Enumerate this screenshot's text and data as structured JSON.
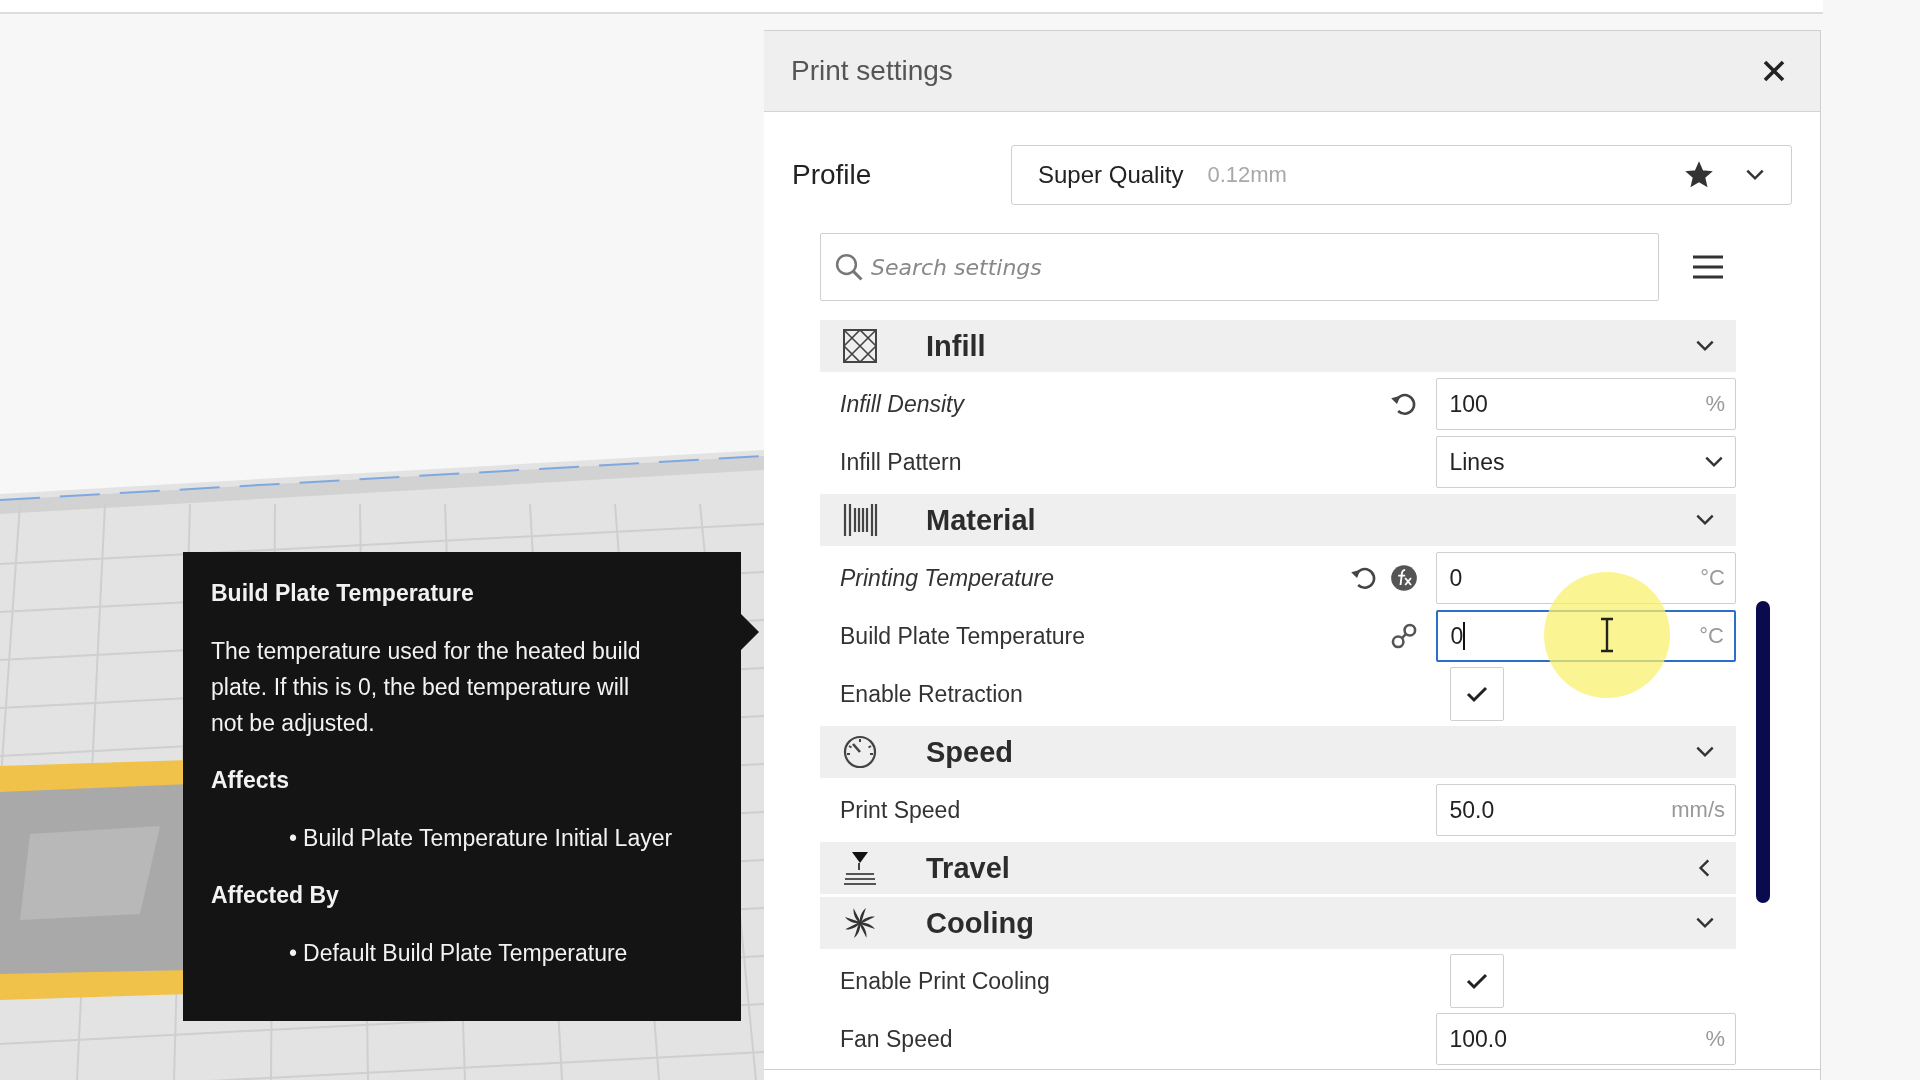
{
  "panel": {
    "title": "Print settings",
    "profile": {
      "label": "Profile",
      "name": "Super Quality",
      "detail": "0.12mm",
      "favorite": true
    },
    "search": {
      "placeholder": "Search settings"
    },
    "sections": [
      {
        "title": "Infill",
        "expanded": true,
        "settings": [
          {
            "label": "Infill Density",
            "kind": "number",
            "value": "100",
            "unit": "%",
            "modified": true,
            "reset": true,
            "focused": false
          },
          {
            "label": "Infill Pattern",
            "kind": "select",
            "value": "Lines",
            "modified": false
          }
        ]
      },
      {
        "title": "Material",
        "expanded": true,
        "settings": [
          {
            "label": "Printing Temperature",
            "kind": "number",
            "value": "0",
            "unit": "°C",
            "modified": true,
            "reset": true,
            "formula": true,
            "focused": false
          },
          {
            "label": "Build Plate Temperature",
            "kind": "number",
            "value": "0",
            "unit": "°C",
            "modified": false,
            "linked": true,
            "focused": true
          },
          {
            "label": "Enable Retraction",
            "kind": "checkbox",
            "checked": true,
            "modified": false
          }
        ]
      },
      {
        "title": "Speed",
        "expanded": true,
        "settings": [
          {
            "label": "Print Speed",
            "kind": "number",
            "value": "50.0",
            "unit": "mm/s",
            "modified": false,
            "focused": false
          }
        ]
      },
      {
        "title": "Travel",
        "expanded": false
      },
      {
        "title": "Cooling",
        "expanded": true,
        "settings": [
          {
            "label": "Enable Print Cooling",
            "kind": "checkbox",
            "checked": true,
            "modified": false
          },
          {
            "label": "Fan Speed",
            "kind": "number",
            "value": "100.0",
            "unit": "%",
            "modified": false,
            "focused": false
          }
        ]
      }
    ]
  },
  "tooltip": {
    "title": "Build Plate Temperature",
    "description": "The temperature used for the heated build plate. If this is 0, the bed temperature will not be adjusted.",
    "groups": [
      {
        "heading": "Affects",
        "items": [
          {
            "bullet": "•",
            "text": "Build Plate Temperature Initial Layer"
          }
        ]
      },
      {
        "heading": "Affected By",
        "items": [
          {
            "bullet": "•",
            "text": "Default Build Plate Temperature"
          }
        ]
      }
    ]
  }
}
